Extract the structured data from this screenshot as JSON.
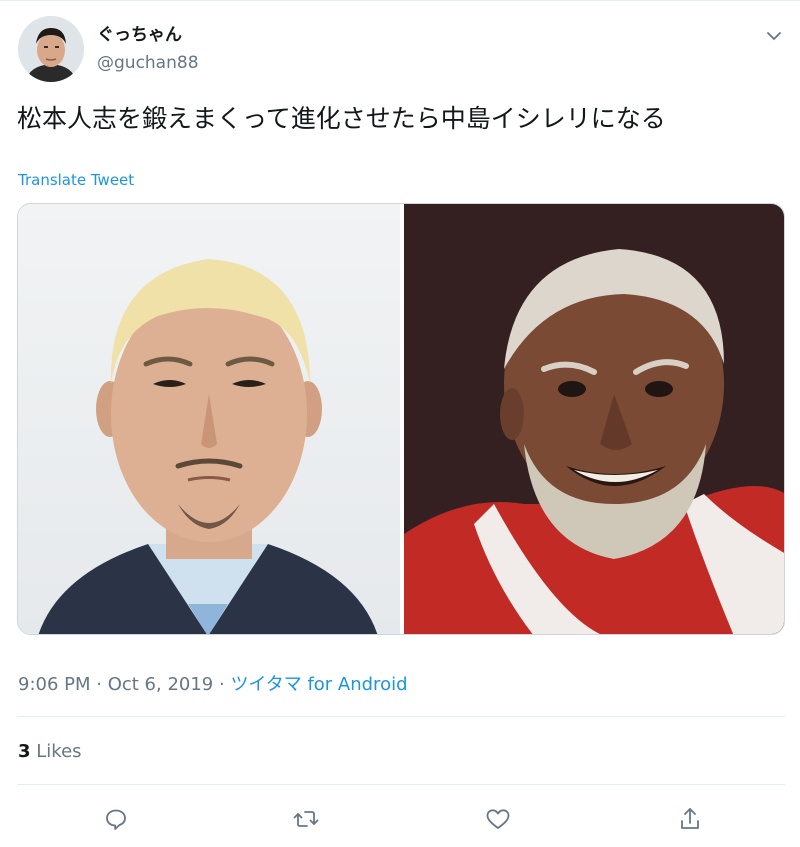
{
  "user": {
    "display_name": "ぐっちゃん",
    "handle": "@guchan88"
  },
  "tweet": {
    "text": "松本人志を鍛えまくって進化させたら中島イシレリになる",
    "translate_label": "Translate Tweet"
  },
  "meta": {
    "time": "9:06 PM",
    "separator": " · ",
    "date": "Oct 6, 2019",
    "source": "ツイタマ for Android"
  },
  "stats": {
    "likes_count": "3",
    "likes_label": "Likes"
  },
  "colors": {
    "link": "#1b95e0",
    "secondary_text": "#657786",
    "border": "#e6ecf0"
  },
  "actions": [
    "reply-icon",
    "retweet-icon",
    "like-icon",
    "share-icon"
  ]
}
